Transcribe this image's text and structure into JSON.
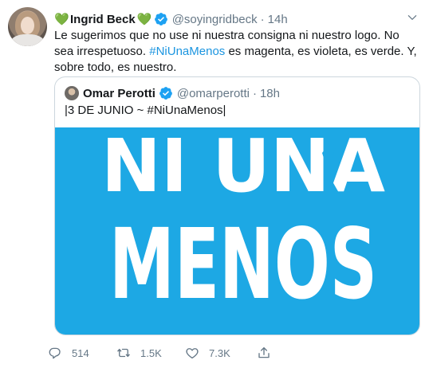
{
  "tweet": {
    "name_prefix_emoji": "💚",
    "display_name": "Ingrid Beck",
    "name_suffix_emoji": "💚",
    "handle": "@soyingridbeck",
    "separator": "·",
    "time": "14h",
    "text_before": "Le sugerimos que no use ni nuestra consigna ni nuestro logo. No sea irrespetuoso. ",
    "hashtag": "#NiUnaMenos",
    "text_after": " es magenta, es violeta, es verde. Y, sobre todo, es nuestro."
  },
  "quoted": {
    "display_name": "Omar Perotti",
    "handle": "@omarperotti",
    "separator": "·",
    "time": "18h",
    "text": "|3 DE JUNIO ~ #NiUnaMenos|",
    "media": {
      "line1": "NI UNA",
      "line2": "MENOS",
      "background": "#1da8e4",
      "foreground": "#ffffff"
    }
  },
  "actions": {
    "reply_count": "514",
    "retweet_count": "1.5K",
    "like_count": "7.3K"
  },
  "colors": {
    "accent": "#1da1f2",
    "link": "#1b95e0",
    "muted": "#657786",
    "heart": "#77b255"
  }
}
